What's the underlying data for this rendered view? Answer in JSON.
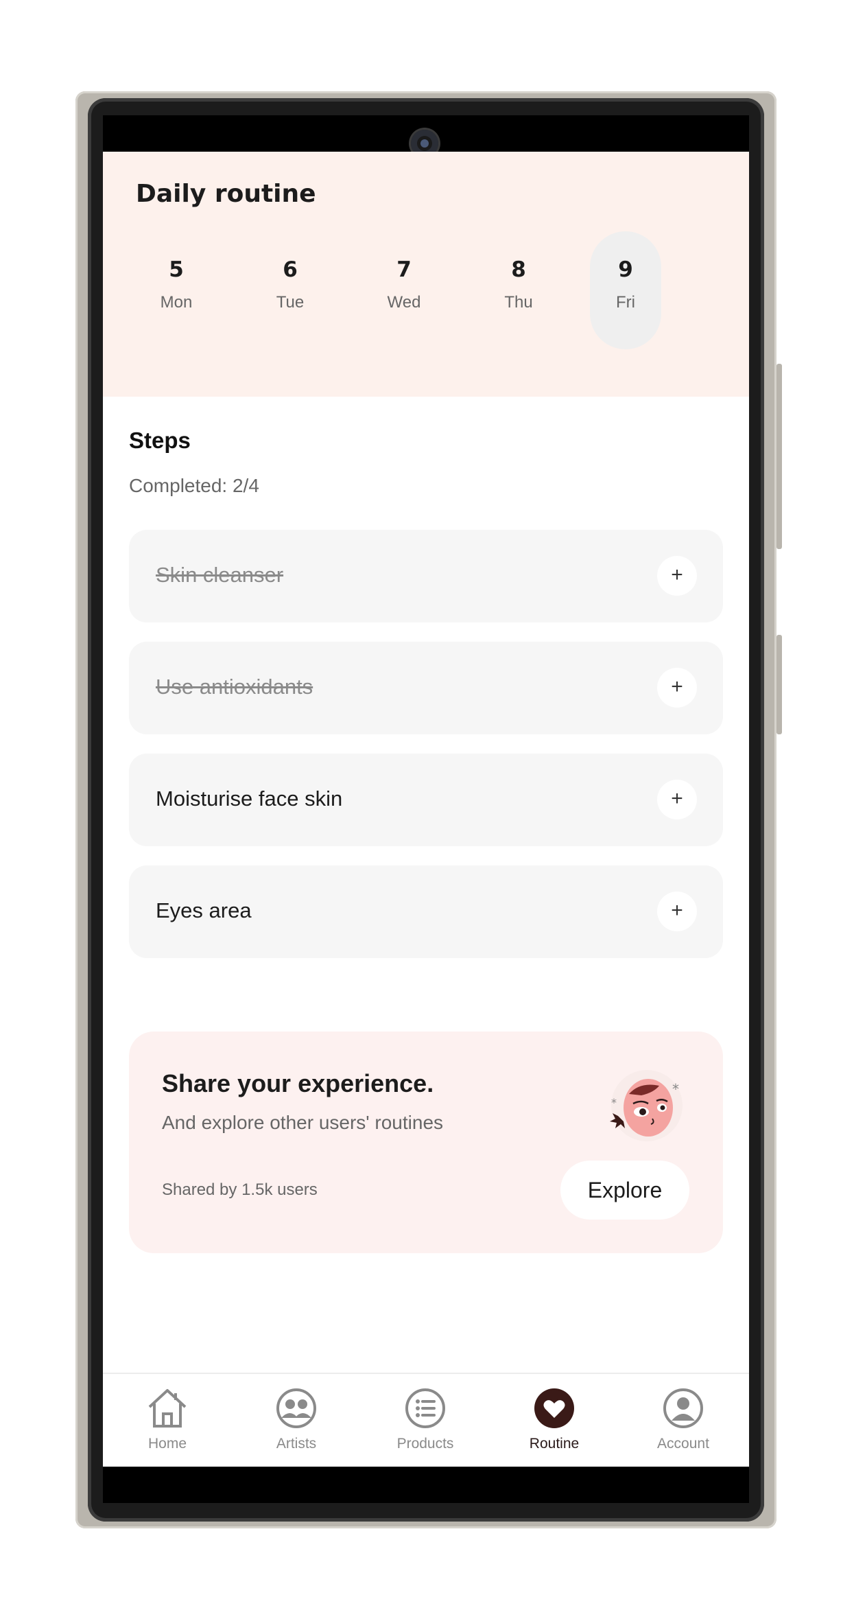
{
  "header": {
    "title": "Daily routine"
  },
  "days": [
    {
      "num": "5",
      "name": "Mon"
    },
    {
      "num": "6",
      "name": "Tue"
    },
    {
      "num": "7",
      "name": "Wed"
    },
    {
      "num": "8",
      "name": "Thu"
    },
    {
      "num": "9",
      "name": "Fri",
      "selected": true
    }
  ],
  "steps": {
    "title": "Steps",
    "completed": "Completed: 2/4",
    "items": [
      {
        "label": "Skin cleanser",
        "done": true
      },
      {
        "label": "Use antioxidants",
        "done": true
      },
      {
        "label": "Moisturise face skin",
        "done": false
      },
      {
        "label": "Eyes area",
        "done": false
      }
    ],
    "add_glyph": "+"
  },
  "share": {
    "title": "Share your experience.",
    "subtitle": "And explore other users' routines",
    "count": "Shared by 1.5k users",
    "button": "Explore"
  },
  "nav": {
    "items": [
      {
        "label": "Home",
        "icon": "home-icon"
      },
      {
        "label": "Artists",
        "icon": "people-icon"
      },
      {
        "label": "Products",
        "icon": "list-icon"
      },
      {
        "label": "Routine",
        "icon": "heart-icon",
        "active": true
      },
      {
        "label": "Account",
        "icon": "user-icon"
      }
    ]
  },
  "colors": {
    "header_bg": "#fdf1ec",
    "active_nav": "#3a1a17",
    "card_bg": "#f6f6f6",
    "share_bg": "#fdf1f0"
  }
}
